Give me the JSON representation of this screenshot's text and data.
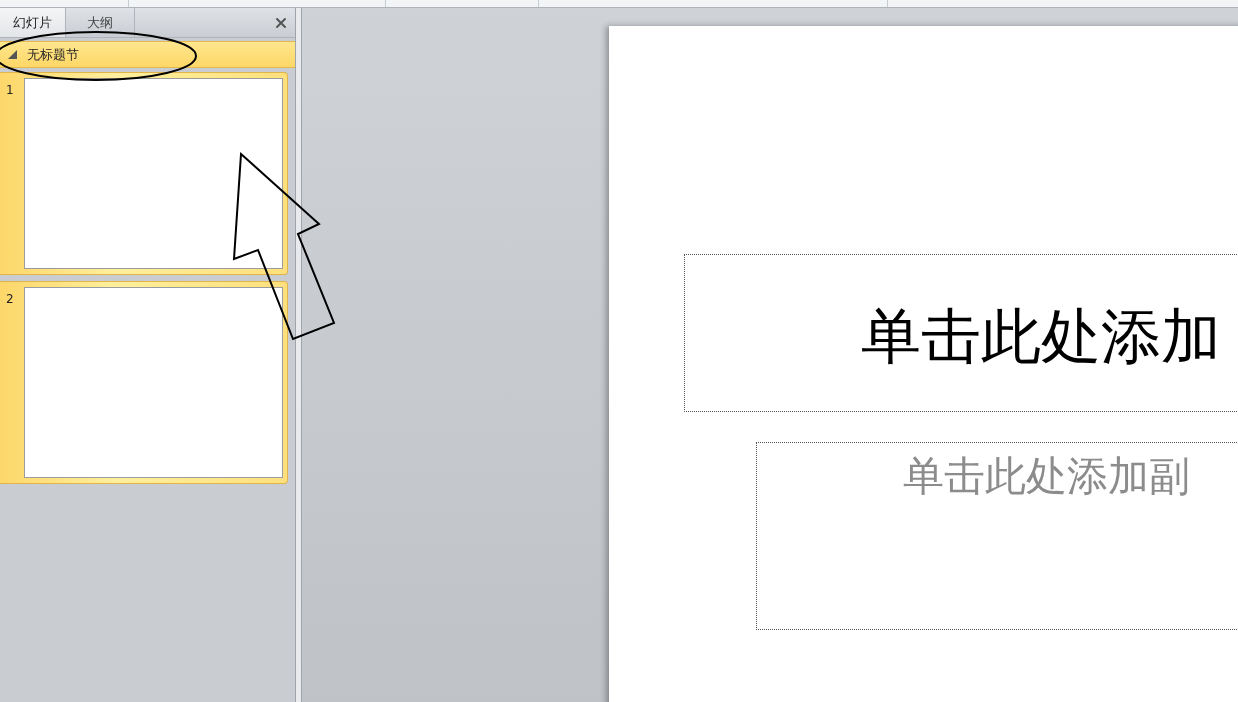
{
  "panel": {
    "tabs": [
      {
        "label": "幻灯片",
        "selected": true
      },
      {
        "label": "大纲",
        "selected": false
      }
    ],
    "section": {
      "title": "无标题节",
      "expanded": true
    },
    "slides": [
      {
        "number": "1",
        "selected": true
      },
      {
        "number": "2",
        "selected": true
      }
    ]
  },
  "slide": {
    "title_placeholder": "单击此处添加",
    "subtitle_placeholder": "单击此处添加副"
  }
}
